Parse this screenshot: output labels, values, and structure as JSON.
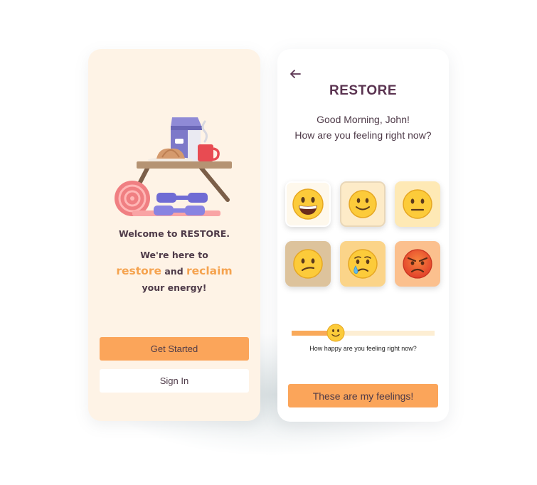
{
  "welcome_screen": {
    "welcome_text": "Welcome to RESTORE.",
    "tagline_line1": "We're here to",
    "tagline_word1": "restore",
    "tagline_and": "and",
    "tagline_word2": "reclaim",
    "tagline_line3": "your energy!",
    "get_started_label": "Get Started",
    "sign_in_label": "Sign In",
    "illustration_icon": "breakfast-table-fitness-illustration"
  },
  "mood_screen": {
    "back_icon": "arrow-left-icon",
    "brand": "RESTORE",
    "greeting_line1": "Good Morning, John!",
    "greeting_line2": "How are you feeling right now?",
    "moods": [
      {
        "name": "grinning-face-icon",
        "bg": "#fef8ec",
        "border": "#ffffff"
      },
      {
        "name": "slightly-smiling-face-icon",
        "bg": "#fdebc8",
        "border": "#e9d7b8"
      },
      {
        "name": "neutral-face-icon",
        "bg": "#fee9b5",
        "border": "#fee9b5"
      },
      {
        "name": "confused-face-icon",
        "bg": "#ddc39c",
        "border": "#ddc39c"
      },
      {
        "name": "crying-face-icon",
        "bg": "#fbd489",
        "border": "#fbd489"
      },
      {
        "name": "angry-face-icon",
        "bg": "#fbc08e",
        "border": "#fbc08e"
      }
    ],
    "slider_value": 0.31,
    "slider_icon": "slightly-smiling-face-icon",
    "slider_question": "How happy are you feeling right now?",
    "submit_label": "These are my feelings!"
  },
  "colors": {
    "accent": "#fba55a",
    "text_dark": "#4e3a48",
    "brand": "#5a3350",
    "welcome_bg": "#fef3e6"
  }
}
